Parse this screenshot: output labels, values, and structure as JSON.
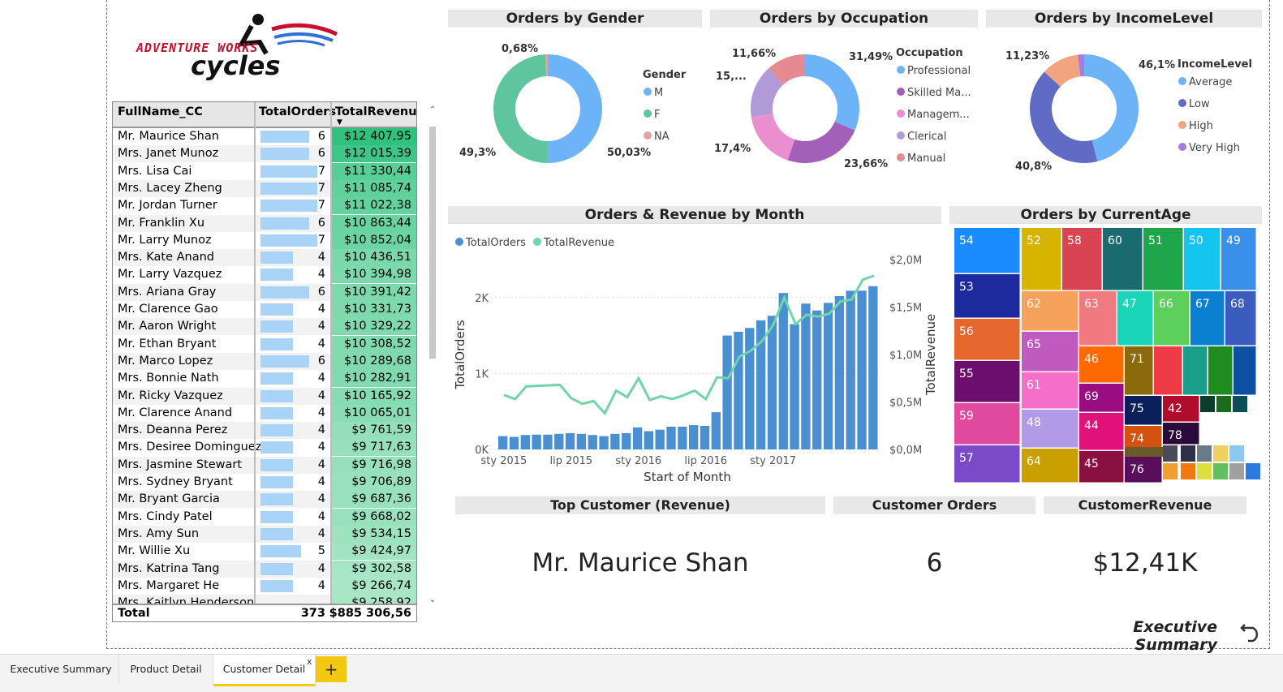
{
  "logo": {
    "line1": "ADVENTURE WORKS",
    "line2": "cycles"
  },
  "table": {
    "headers": {
      "name": "FullName_CC",
      "orders": "TotalOrders",
      "revenue": "TotalRevenue"
    },
    "rows": [
      {
        "name": "Mr. Maurice Shan",
        "orders": "6",
        "revenue": "$12 407,95"
      },
      {
        "name": "Mrs. Janet Munoz",
        "orders": "6",
        "revenue": "$12 015,39"
      },
      {
        "name": "Mrs. Lisa Cai",
        "orders": "7",
        "revenue": "$11 330,44"
      },
      {
        "name": "Mrs. Lacey Zheng",
        "orders": "7",
        "revenue": "$11 085,74"
      },
      {
        "name": "Mr. Jordan Turner",
        "orders": "7",
        "revenue": "$11 022,38"
      },
      {
        "name": "Mr. Franklin Xu",
        "orders": "6",
        "revenue": "$10 863,44"
      },
      {
        "name": "Mr. Larry Munoz",
        "orders": "7",
        "revenue": "$10 852,04"
      },
      {
        "name": "Mrs. Kate Anand",
        "orders": "4",
        "revenue": "$10 436,51"
      },
      {
        "name": "Mr. Larry Vazquez",
        "orders": "4",
        "revenue": "$10 394,98"
      },
      {
        "name": "Mrs. Ariana Gray",
        "orders": "6",
        "revenue": "$10 391,42"
      },
      {
        "name": "Mr. Clarence Gao",
        "orders": "4",
        "revenue": "$10 331,73"
      },
      {
        "name": "Mr. Aaron Wright",
        "orders": "4",
        "revenue": "$10 329,22"
      },
      {
        "name": "Mr. Ethan Bryant",
        "orders": "4",
        "revenue": "$10 308,52"
      },
      {
        "name": "Mr. Marco Lopez",
        "orders": "6",
        "revenue": "$10 289,68"
      },
      {
        "name": "Mrs. Bonnie Nath",
        "orders": "4",
        "revenue": "$10 282,91"
      },
      {
        "name": "Mr. Ricky Vazquez",
        "orders": "4",
        "revenue": "$10 165,92"
      },
      {
        "name": "Mr. Clarence Anand",
        "orders": "4",
        "revenue": "$10 065,01"
      },
      {
        "name": "Mrs. Deanna Perez",
        "orders": "4",
        "revenue": "$9 761,59"
      },
      {
        "name": "Mrs. Desiree Dominguez",
        "orders": "4",
        "revenue": "$9 717,63"
      },
      {
        "name": "Mrs. Jasmine Stewart",
        "orders": "4",
        "revenue": "$9 716,98"
      },
      {
        "name": "Mrs. Sydney Bryant",
        "orders": "4",
        "revenue": "$9 706,89"
      },
      {
        "name": "Mr. Bryant Garcia",
        "orders": "4",
        "revenue": "$9 687,36"
      },
      {
        "name": "Mrs. Cindy Patel",
        "orders": "4",
        "revenue": "$9 668,02"
      },
      {
        "name": "Mrs. Amy Sun",
        "orders": "4",
        "revenue": "$9 534,15"
      },
      {
        "name": "Mr. Willie Xu",
        "orders": "5",
        "revenue": "$9 424,97"
      },
      {
        "name": "Mrs. Katrina Tang",
        "orders": "4",
        "revenue": "$9 302,58"
      },
      {
        "name": "Mrs. Margaret He",
        "orders": "4",
        "revenue": "$9 266,74"
      },
      {
        "name": "Mrs. Kaitlyn Henderson",
        "orders": "",
        "revenue": "$9 258,92"
      }
    ],
    "total": {
      "label": "Total",
      "orders": "373",
      "revenue": "$885 306,56"
    }
  },
  "titles": {
    "gender": "Orders by Gender",
    "occupation": "Orders by Occupation",
    "income": "Orders by IncomeLevel",
    "month": "Orders & Revenue by Month",
    "age": "Orders by CurrentAge",
    "top_customer": "Top Customer (Revenue)",
    "customer_orders": "Customer Orders",
    "customer_revenue": "CustomerRevenue"
  },
  "cards": {
    "top_customer": "Mr. Maurice Shan",
    "customer_orders": "6",
    "customer_revenue": "$12,41K"
  },
  "nav": {
    "executive_summary": "Executive Summary"
  },
  "tabs": [
    "Executive Summary",
    "Product Detail",
    "Customer Detail"
  ],
  "add_tab": "+",
  "tab_close": "x",
  "colors": {
    "revenue_high": "#2ec27e",
    "revenue_low": "#a8e6c6",
    "orders_bar": "#a9d3f7",
    "tab_accent": "#f2c811"
  },
  "chart_data": [
    {
      "type": "pie",
      "title": "Orders by Gender",
      "legend_title": "Gender",
      "labels": [
        "M",
        "F",
        "NA"
      ],
      "values": [
        50.03,
        49.3,
        0.68
      ],
      "value_labels": [
        "50,03%",
        "49,3%",
        "0,68%"
      ],
      "colors": [
        "#6cb4f7",
        "#5fc59f",
        "#e8a0a6"
      ]
    },
    {
      "type": "pie",
      "title": "Orders by Occupation",
      "legend_title": "Occupation",
      "labels": [
        "Professional",
        "Skilled Ma...",
        "Managem...",
        "Clerical",
        "Manual"
      ],
      "values": [
        31.49,
        23.66,
        17.4,
        15.79,
        11.66
      ],
      "value_labels": [
        "31,49%",
        "23,66%",
        "17,4%",
        "15,...",
        "11,66%"
      ],
      "colors": [
        "#6cb4f7",
        "#a45fb8",
        "#e98fcf",
        "#b09ad8",
        "#e58a90"
      ]
    },
    {
      "type": "pie",
      "title": "Orders by IncomeLevel",
      "legend_title": "IncomeLevel",
      "labels": [
        "Average",
        "Low",
        "High",
        "Very High"
      ],
      "values": [
        46.1,
        40.8,
        11.23,
        1.87
      ],
      "value_labels": [
        "46,1%",
        "40,8%",
        "11,23%",
        ""
      ],
      "colors": [
        "#6cb4f7",
        "#5f6bc4",
        "#f2a37f",
        "#a97be0"
      ]
    },
    {
      "type": "bar",
      "title": "Orders & Revenue by Month",
      "xlabel": "Start of Month",
      "ylabel": "TotalOrders",
      "y2label": "TotalRevenue",
      "x_ticks": [
        "sty 2015",
        "lip 2015",
        "sty 2016",
        "lip 2016",
        "sty 2017"
      ],
      "y_ticks": [
        "0K",
        "1K",
        "2K"
      ],
      "y2_ticks": [
        "$0,0M",
        "$0,5M",
        "$1,0M",
        "$1,5M",
        "$2,0M"
      ],
      "ylim": [
        0,
        2500
      ],
      "y2lim": [
        0,
        2000000
      ],
      "series": [
        {
          "name": "TotalOrders",
          "color": "#4a8fd1",
          "values": [
            175,
            165,
            190,
            195,
            195,
            205,
            215,
            205,
            190,
            175,
            205,
            215,
            290,
            240,
            260,
            300,
            300,
            320,
            310,
            490,
            1500,
            1550,
            1600,
            1700,
            1760,
            2060,
            1650,
            1920,
            1830,
            1930,
            2020,
            2090,
            2090,
            2150
          ]
        },
        {
          "name": "TotalRevenue",
          "color": "#6fd6ac",
          "values": [
            575000,
            530000,
            665000,
            670000,
            675000,
            680000,
            540000,
            480000,
            510000,
            380000,
            620000,
            550000,
            750000,
            520000,
            560000,
            530000,
            570000,
            620000,
            530000,
            760000,
            750000,
            980000,
            1040000,
            1140000,
            1310000,
            1600000,
            1320000,
            1420000,
            1400000,
            1430000,
            1560000,
            1580000,
            1790000,
            1830000
          ]
        }
      ]
    },
    {
      "type": "heatmap",
      "title": "Orders by CurrentAge",
      "labels": [
        "54",
        "53",
        "56",
        "55",
        "59",
        "57",
        "52",
        "58",
        "60",
        "51",
        "50",
        "49",
        "62",
        "63",
        "47",
        "66",
        "67",
        "68",
        "65",
        "46",
        "71",
        "61",
        "69",
        "75",
        "42",
        "48",
        "44",
        "78",
        "74",
        "64",
        "45",
        "76"
      ]
    }
  ]
}
